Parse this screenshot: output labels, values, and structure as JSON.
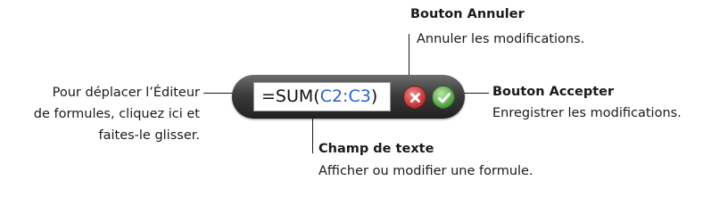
{
  "formula_editor": {
    "formula_prefix": "=SUM(",
    "formula_reference": "C2:C3",
    "formula_suffix": ")",
    "reference_color": "#2a62c9",
    "cancel_icon": "x-icon",
    "accept_icon": "checkmark-icon"
  },
  "callouts": {
    "cancel": {
      "title": "Bouton Annuler",
      "description": "Annuler les modifications."
    },
    "accept": {
      "title": "Bouton Accepter",
      "description": "Enregistrer les modifications."
    },
    "text_field": {
      "title": "Champ de texte",
      "description": "Afficher ou modifier une formule."
    },
    "drag": {
      "line1": "Pour déplacer l’Éditeur",
      "line2": "de formules, cliquez ici et",
      "line3": "faites-le glisser."
    }
  }
}
